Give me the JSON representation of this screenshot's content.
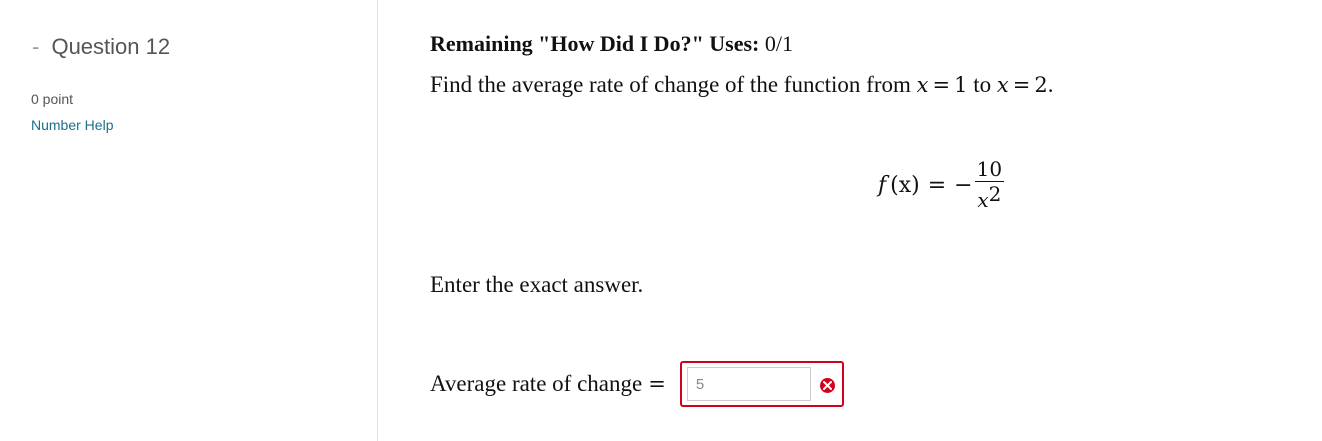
{
  "sidebar": {
    "dash": "-",
    "question_title": "Question 12",
    "points": "0 point",
    "help_link": "Number Help"
  },
  "main": {
    "remaining_label": "Remaining \"How Did I Do?\" Uses:",
    "remaining_value": "0/1",
    "prompt": {
      "before": "Find the average rate of change of the function from",
      "var1": "x",
      "eq1": "=",
      "val1": "1",
      "to": "to",
      "var2": "x",
      "eq2": "=",
      "val2": "2",
      "end": "."
    },
    "formula": {
      "fn": "f",
      "arg": "(x)",
      "eq": "=",
      "sign": "−",
      "numerator": "10",
      "denominator_base": "x",
      "denominator_exp": "2"
    },
    "instruction": "Enter the exact answer.",
    "answer": {
      "label": "Average rate of change",
      "eq": "=",
      "value": "5",
      "status": "incorrect",
      "status_icon": "error-x-icon"
    }
  },
  "colors": {
    "error": "#d0021b",
    "link": "#1c6e8c",
    "muted_text": "#555555"
  }
}
